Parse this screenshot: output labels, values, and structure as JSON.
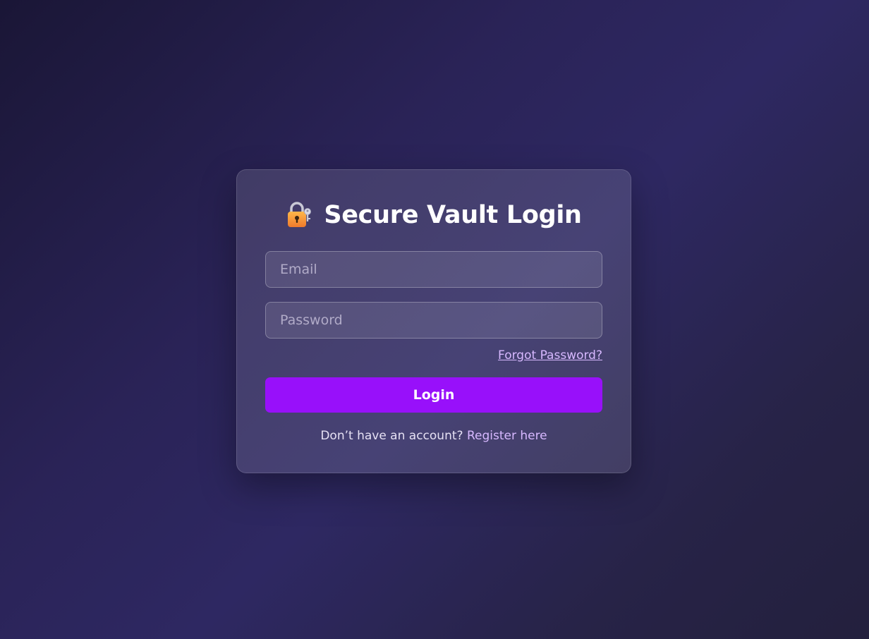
{
  "login": {
    "title": "Secure Vault Login",
    "icon": "lock-with-key-icon",
    "email_placeholder": "Email",
    "password_placeholder": "Password",
    "forgot_password": "Forgot Password?",
    "login_button": "Login",
    "signup_prompt": "Don’t have an account?",
    "register_link": "Register here"
  },
  "colors": {
    "accent": "#9810fa",
    "link": "#d7b8ff",
    "background": "#2a2357"
  }
}
